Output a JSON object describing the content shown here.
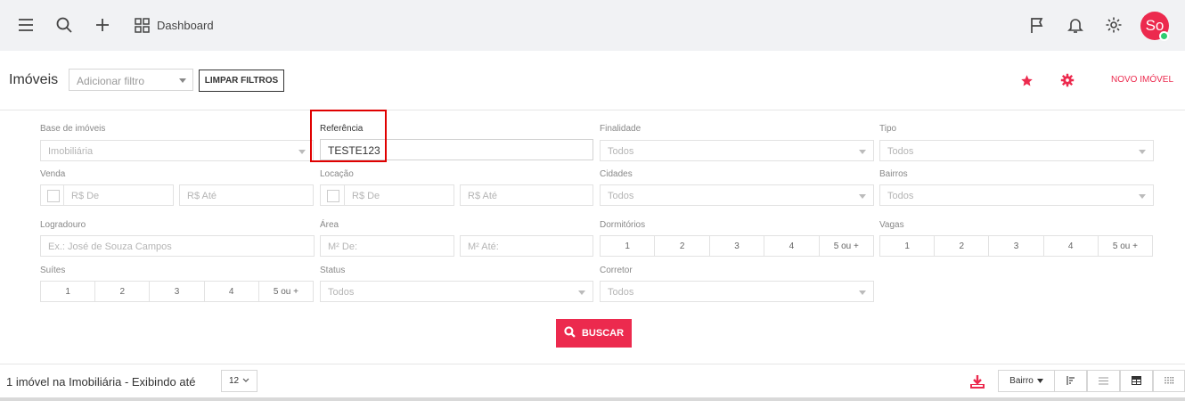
{
  "topbar": {
    "dashboard_label": "Dashboard",
    "avatar_initials": "So",
    "icons": [
      "menu-icon",
      "search-icon",
      "plus-icon",
      "grid-icon",
      "flag-icon",
      "bell-icon",
      "gear-icon"
    ]
  },
  "header": {
    "title": "Imóveis",
    "filter_placeholder": "Adicionar filtro",
    "clear_filters": "LIMPAR FILTROS",
    "new_property": "NOVO IMÓVEL"
  },
  "form": {
    "base": {
      "label": "Base de imóveis",
      "value": "Imobiliária"
    },
    "referencia": {
      "label": "Referência",
      "value": "TESTE123"
    },
    "finalidade": {
      "label": "Finalidade",
      "placeholder": "Todos"
    },
    "tipo": {
      "label": "Tipo",
      "placeholder": "Todos"
    },
    "venda": {
      "label": "Venda",
      "from": "R$ De",
      "to": "R$ Até"
    },
    "locacao": {
      "label": "Locação",
      "from": "R$ De",
      "to": "R$ Até"
    },
    "cidades": {
      "label": "Cidades",
      "placeholder": "Todos"
    },
    "bairros": {
      "label": "Bairros",
      "placeholder": "Todos"
    },
    "logradouro": {
      "label": "Logradouro",
      "placeholder": "Ex.: José de Souza Campos"
    },
    "area": {
      "label": "Área",
      "from": "M² De:",
      "to": "M² Até:"
    },
    "dormitorios": {
      "label": "Dormitórios",
      "options": [
        "1",
        "2",
        "3",
        "4",
        "5 ou +"
      ]
    },
    "vagas": {
      "label": "Vagas",
      "options": [
        "1",
        "2",
        "3",
        "4",
        "5 ou +"
      ]
    },
    "suites": {
      "label": "Suítes",
      "options": [
        "1",
        "2",
        "3",
        "4",
        "5 ou +"
      ]
    },
    "status": {
      "label": "Status",
      "placeholder": "Todos"
    },
    "corretor": {
      "label": "Corretor",
      "placeholder": "Todos"
    },
    "search_button": "BUSCAR"
  },
  "footer": {
    "result_text": "1 imóvel na Imobiliária - Exibindo até",
    "per_page": "12",
    "sort_label": "Bairro"
  },
  "colors": {
    "accent": "#ec2a4e",
    "highlight": "#e00000",
    "status_online": "#2ecc71"
  }
}
